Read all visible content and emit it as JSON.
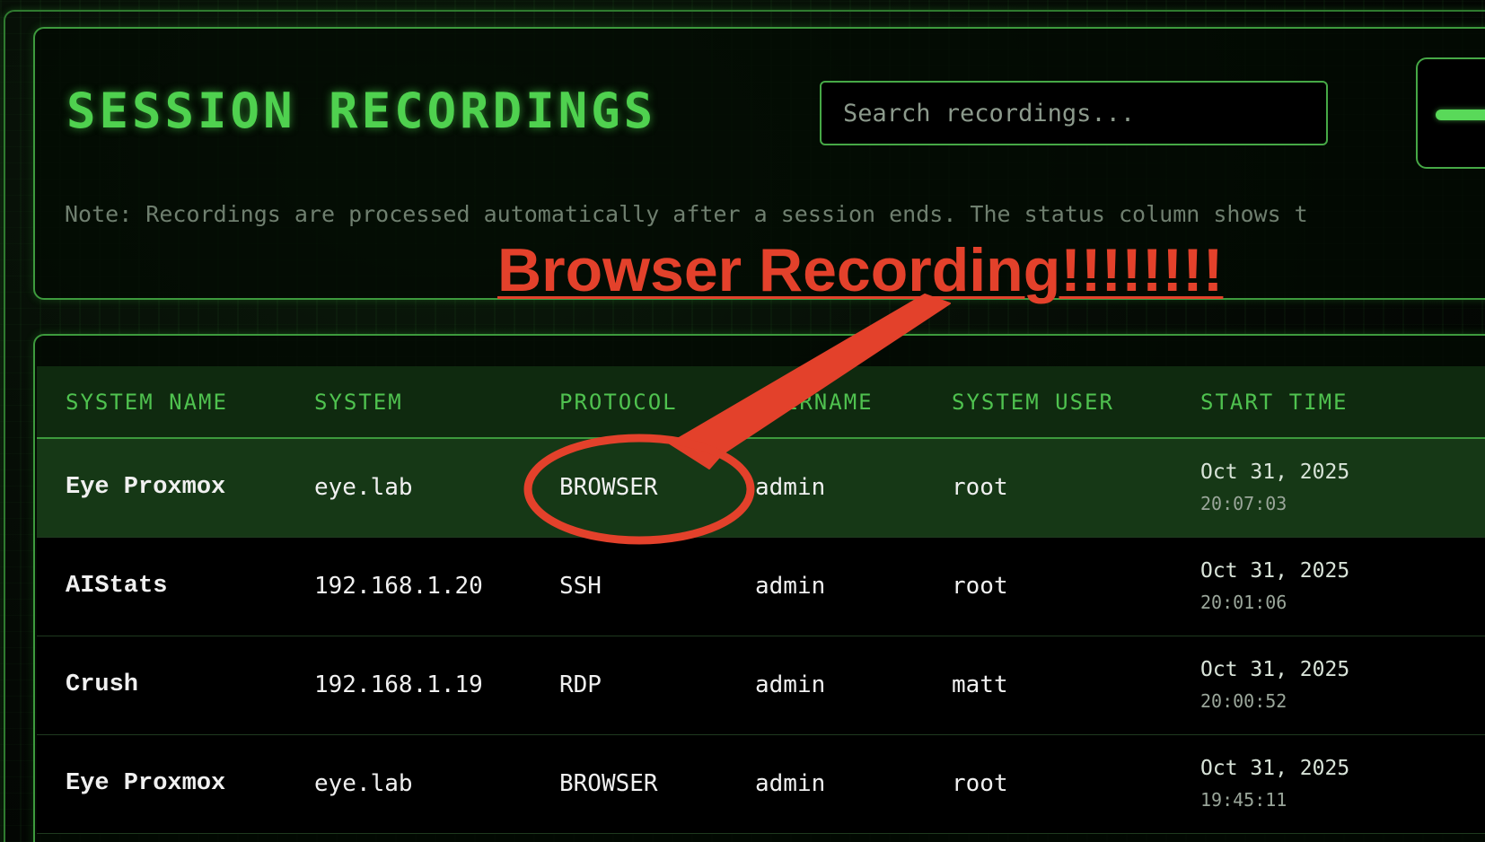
{
  "header": {
    "title": "SESSION RECORDINGS",
    "search_placeholder": "Search recordings...",
    "note": "Note: Recordings are processed automatically after a session ends. The status column shows t"
  },
  "table": {
    "columns": [
      "SYSTEM NAME",
      "SYSTEM",
      "PROTOCOL",
      "USERNAME",
      "SYSTEM USER",
      "START TIME"
    ],
    "rows": [
      {
        "system_name": "Eye Proxmox",
        "system": "eye.lab",
        "protocol": "BROWSER",
        "username": "admin",
        "system_user": "root",
        "start_date": "Oct 31, 2025",
        "start_time": "20:07:03"
      },
      {
        "system_name": "AIStats",
        "system": "192.168.1.20",
        "protocol": "SSH",
        "username": "admin",
        "system_user": "root",
        "start_date": "Oct 31, 2025",
        "start_time": "20:01:06"
      },
      {
        "system_name": "Crush",
        "system": "192.168.1.19",
        "protocol": "RDP",
        "username": "admin",
        "system_user": "matt",
        "start_date": "Oct 31, 2025",
        "start_time": "20:00:52"
      },
      {
        "system_name": "Eye Proxmox",
        "system": "eye.lab",
        "protocol": "BROWSER",
        "username": "admin",
        "system_user": "root",
        "start_date": "Oct 31, 2025",
        "start_time": "19:45:11"
      }
    ]
  },
  "annotation": {
    "label": "Browser Recording!!!!!!!!",
    "color": "#e3412b"
  },
  "colors": {
    "accent": "#4fd14f",
    "highlight_row": "#163816",
    "border": "#3d9a3d"
  }
}
